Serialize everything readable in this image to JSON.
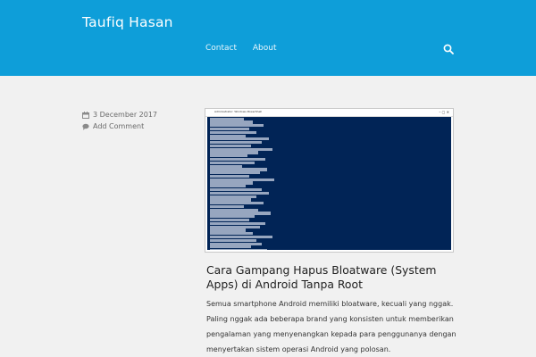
{
  "header": {
    "site_title": "Taufiq Hasan",
    "nav": [
      "Contact",
      "About"
    ],
    "background": "#0e9ed9",
    "search_icon": "search-icon"
  },
  "post": {
    "date": "3 December 2017",
    "comment_link": "Add Comment",
    "date_icon": "calendar-icon",
    "comment_icon": "comment-icon",
    "thumbnail": {
      "window_title": "Administrator: Windows PowerShell",
      "console_color": "#012456"
    },
    "title": "Cara Gampang Hapus Bloatware (System Apps) di Android Tanpa Root",
    "excerpt": "Semua smartphone Android memiliki bloatware, kecuali yang nggak. Paling nggak ada beberapa brand yang konsisten untuk memberikan pengalaman yang menyenangkan kepada para penggunanya dengan menyertakan sistem operasi Android yang polosan."
  }
}
